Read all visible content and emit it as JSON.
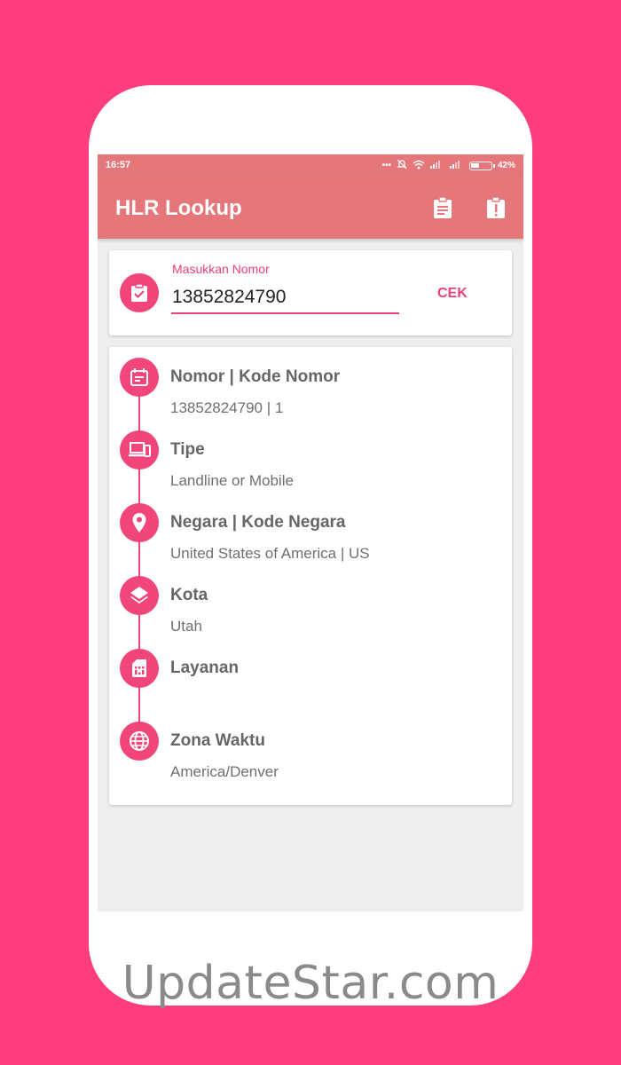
{
  "status_bar": {
    "time": "16:57",
    "battery": "42%"
  },
  "app": {
    "title": "HLR Lookup",
    "actions": [
      "clipboard-icon",
      "clipboard-alert-icon"
    ]
  },
  "input": {
    "label": "Masukkan Nomor",
    "value": "13852824790",
    "check_button": "CEK"
  },
  "results": [
    {
      "label": "Nomor | Kode Nomor",
      "value": "13852824790 | 1",
      "icon": "calendar-note-icon"
    },
    {
      "label": "Tipe",
      "value": "Landline or Mobile",
      "icon": "devices-icon"
    },
    {
      "label": "Negara | Kode Negara",
      "value": "United States of America | US",
      "icon": "location-pin-icon"
    },
    {
      "label": "Kota",
      "value": "Utah",
      "icon": "layers-icon"
    },
    {
      "label": "Layanan",
      "value": "",
      "icon": "sim-card-icon"
    },
    {
      "label": "Zona Waktu",
      "value": "America/Denver",
      "icon": "globe-icon"
    }
  ],
  "colors": {
    "background": "#fd3d7d",
    "appbar": "#e5777b",
    "accent": "#e8427a"
  },
  "watermark": "UpdateStar.com"
}
